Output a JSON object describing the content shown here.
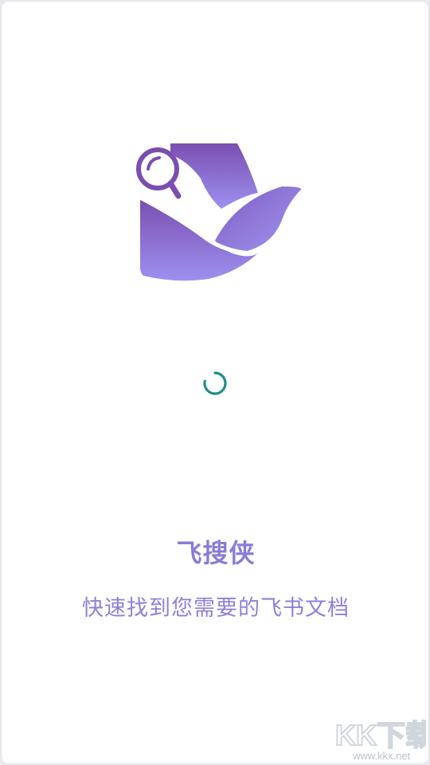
{
  "app": {
    "name": "飞搜侠",
    "tagline": "快速找到您需要的飞书文档"
  },
  "watermark": {
    "brand": "KK下载",
    "domain": "www.kkx.net"
  },
  "colors": {
    "brand_purple_top": "#7a4fb0",
    "brand_purple_bottom": "#9d90f0",
    "title_color": "#8a7bd6",
    "spinner": "#1f8f87"
  },
  "icons": {
    "logo": "search-bird-logo-icon",
    "spinner": "loading-spinner-icon"
  }
}
